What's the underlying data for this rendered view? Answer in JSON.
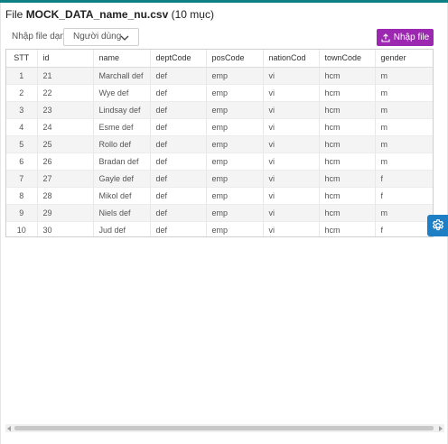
{
  "header": {
    "file_prefix": "File",
    "file_name": "MOCK_DATA_name_nu.csv",
    "file_count": "(10 mục)"
  },
  "toolbar": {
    "type_label": "Nhập file dạng",
    "type_value": "Người dùng",
    "import_label": "Nhập file"
  },
  "table": {
    "columns": [
      "STT",
      "id",
      "name",
      "deptCode",
      "posCode",
      "nationCod",
      "townCode",
      "gender"
    ],
    "rows": [
      [
        "1",
        "21",
        "Marchall def",
        "def",
        "emp",
        "vi",
        "hcm",
        "m"
      ],
      [
        "2",
        "22",
        "Wye def",
        "def",
        "emp",
        "vi",
        "hcm",
        "m"
      ],
      [
        "3",
        "23",
        "Lindsay def",
        "def",
        "emp",
        "vi",
        "hcm",
        "m"
      ],
      [
        "4",
        "24",
        "Esme def",
        "def",
        "emp",
        "vi",
        "hcm",
        "m"
      ],
      [
        "5",
        "25",
        "Rollo def",
        "def",
        "emp",
        "vi",
        "hcm",
        "m"
      ],
      [
        "6",
        "26",
        "Bradan def",
        "def",
        "emp",
        "vi",
        "hcm",
        "m"
      ],
      [
        "7",
        "27",
        "Gayle def",
        "def",
        "emp",
        "vi",
        "hcm",
        "f"
      ],
      [
        "8",
        "28",
        "Mikol def",
        "def",
        "emp",
        "vi",
        "hcm",
        "f"
      ],
      [
        "9",
        "29",
        "Niels def",
        "def",
        "emp",
        "vi",
        "hcm",
        "m"
      ],
      [
        "10",
        "30",
        "Jud def",
        "def",
        "emp",
        "vi",
        "hcm",
        "f"
      ]
    ]
  },
  "icons": {
    "select_chevron": "chevron-down-icon",
    "import": "upload-icon",
    "settings": "gear-icon"
  },
  "colors": {
    "accent_top": "#0f7f86",
    "import_button": "#9c27b0",
    "settings_tab": "#1e7fc4"
  }
}
